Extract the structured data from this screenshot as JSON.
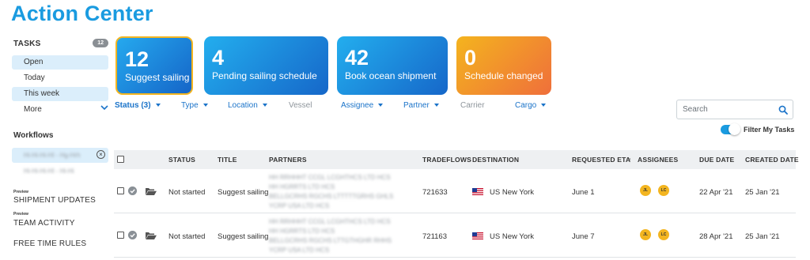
{
  "app": {
    "title": "Action Center"
  },
  "sidebar": {
    "tasks_label": "TASKS",
    "tasks_count": "12",
    "items": [
      {
        "label": "Open",
        "selected": true
      },
      {
        "label": "Today",
        "selected": false
      },
      {
        "label": "This week",
        "selected": true
      },
      {
        "label": "More",
        "selected": false
      }
    ],
    "workflows_label": "Workflows",
    "workflows": [
      {
        "label": "Hi-Hi-Hi-HI - Hg-Hrh",
        "selected": true
      },
      {
        "label": "Hi-Hi-Hi-HI - Hi-Hi",
        "selected": false
      }
    ],
    "preview_tag": "Preview",
    "links": [
      "SHIPMENT UPDATES",
      "TEAM ACTIVITY",
      "FREE TIME RULES"
    ]
  },
  "cards": [
    {
      "count": "12",
      "label": "Suggest sailing"
    },
    {
      "count": "4",
      "label": "Pending sailing schedule"
    },
    {
      "count": "42",
      "label": "Book ocean shipment"
    },
    {
      "count": "0",
      "label": "Schedule changed"
    }
  ],
  "filters": {
    "status": "Status (3)",
    "type": "Type",
    "location": "Location",
    "vessel": "Vessel",
    "assignee": "Assignee",
    "partner": "Partner",
    "carrier": "Carrier",
    "cargo": "Cargo"
  },
  "search": {
    "placeholder": "Search",
    "value": ""
  },
  "filter_my_tasks": {
    "label": "Filter My Tasks",
    "on": true
  },
  "table": {
    "headers": {
      "status": "STATUS",
      "title": "TITLE",
      "partners": "PARTNERS",
      "tradeflows": "TRADEFLOWS",
      "destination": "DESTINATION",
      "requested_eta": "REQUESTED ETA",
      "sort_arrow": "↑",
      "assignees": "ASSIGNEES",
      "due_date": "DUE DATE",
      "created_date": "CREATED DATE"
    },
    "rows": [
      {
        "status": "Not started",
        "title": "Suggest sailing",
        "partners": [
          "HH RRHHHT CCGL LCGHTHCS LTD HCS",
          "HH HGRRTS LTD HCS",
          "BELLGCRHS RGCHS LTTTTTGRHS GHLS",
          "YCRP USA LTD HCS"
        ],
        "tradeflow": "721633",
        "destination": "US New York",
        "requested_eta": "June 1",
        "assignees": [
          "JL",
          "LC"
        ],
        "due_date": "22 Apr '21",
        "created_date": "25 Jan '21"
      },
      {
        "status": "Not started",
        "title": "Suggest sailing",
        "partners": [
          "HH RRHHHT CCGL LCGHTHCS LTD HCS",
          "HH HGRRTS LTD HCS",
          "BELLGCRHS RGCHS LTTGTHGHR RHHS",
          "YCRP USA LTD HCS"
        ],
        "tradeflow": "721163",
        "destination": "US New York",
        "requested_eta": "June 7",
        "assignees": [
          "JL",
          "LC"
        ],
        "due_date": "28 Apr '21",
        "created_date": "25 Jan '21"
      }
    ]
  }
}
